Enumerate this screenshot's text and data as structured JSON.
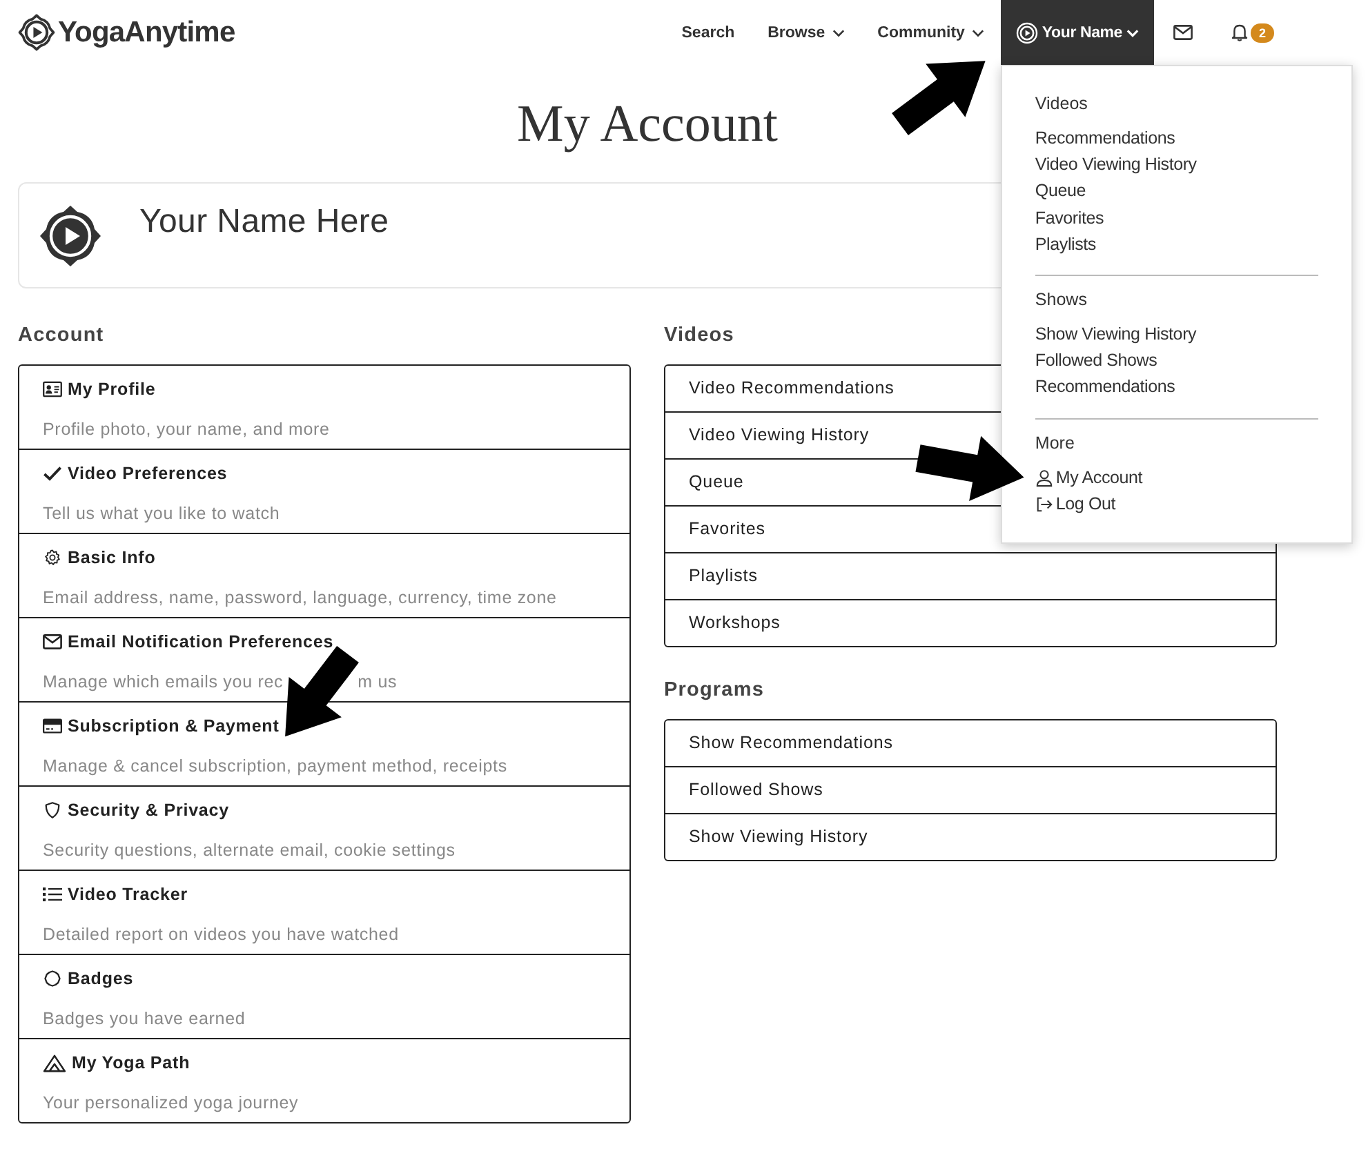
{
  "header": {
    "logo": "YogaAnytime",
    "nav": [
      {
        "label": "Search",
        "kind": "link"
      },
      {
        "label": "Browse",
        "kind": "menu",
        "expanded": false
      },
      {
        "label": "Community",
        "kind": "menu",
        "expanded": false
      },
      {
        "label": "Your Name",
        "kind": "account",
        "expanded": true
      }
    ],
    "notifications": {
      "badge": "2"
    }
  },
  "page_title": "My Account",
  "profile": {
    "name": "Your Name Here"
  },
  "account": {
    "heading": "Account",
    "items": [
      {
        "kind": "profile",
        "title": "My Profile",
        "description": "Profile photo, your name, and more"
      },
      {
        "kind": "check",
        "title": "Video Preferences",
        "description": "Tell us what you like to watch"
      },
      {
        "kind": "gear",
        "title": "Basic Info",
        "description": "Email address, name, password, language, currency, time zone"
      },
      {
        "kind": "mail",
        "title": "Email Notification Preferences",
        "description": "Manage which emails you rec",
        "description_tail": "m us"
      },
      {
        "kind": "card",
        "title": "Subscription & Payment",
        "description": "Manage & cancel subscription, payment method, receipts"
      },
      {
        "kind": "shield",
        "title": "Security & Privacy",
        "description": "Security questions, alternate email, cookie settings"
      },
      {
        "kind": "list",
        "title": "Video Tracker",
        "description": "Detailed report on videos you have watched"
      },
      {
        "kind": "badge",
        "title": "Badges",
        "description": "Badges you have earned"
      },
      {
        "kind": "path",
        "title": "My Yoga Path",
        "description": "Your personalized yoga journey"
      }
    ]
  },
  "videos": {
    "heading": "Videos",
    "items": [
      "Video Recommendations",
      "Video Viewing History",
      "Queue",
      "Favorites",
      "Playlists",
      "Workshops"
    ]
  },
  "programs": {
    "heading": "Programs",
    "items": [
      "Show Recommendations",
      "Followed Shows",
      "Show Viewing History"
    ]
  },
  "account_menu": {
    "sections": [
      {
        "heading": "Videos",
        "items": [
          {
            "kind": "link",
            "label": "Recommendations"
          },
          {
            "kind": "link",
            "label": "Video Viewing History"
          },
          {
            "kind": "link",
            "label": "Queue"
          },
          {
            "kind": "link",
            "label": "Favorites"
          },
          {
            "kind": "link",
            "label": "Playlists"
          }
        ]
      },
      {
        "heading": "Shows",
        "items": [
          {
            "kind": "link",
            "label": "Show Viewing History"
          },
          {
            "kind": "link",
            "label": "Followed Shows"
          },
          {
            "kind": "link",
            "label": "Recommendations"
          }
        ]
      },
      {
        "heading": "More",
        "items": [
          {
            "kind": "account",
            "label": "My Account"
          },
          {
            "kind": "logout",
            "label": "Log Out"
          }
        ]
      }
    ]
  }
}
